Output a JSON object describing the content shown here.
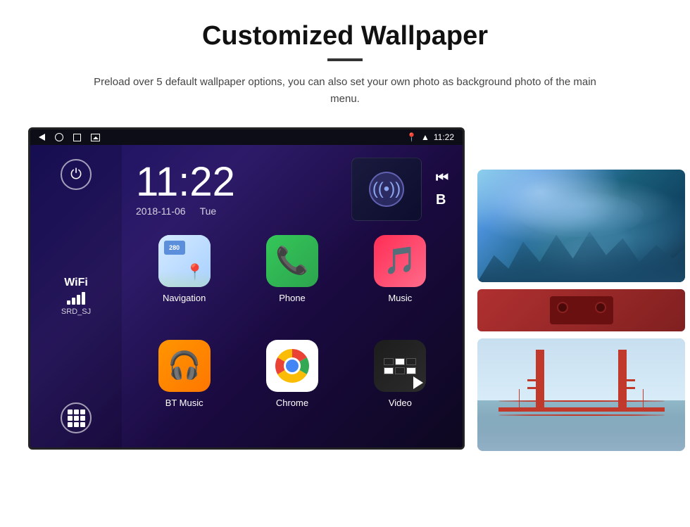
{
  "page": {
    "title": "Customized Wallpaper",
    "subtitle": "Preload over 5 default wallpaper options, you can also set your own photo as background photo of the main menu."
  },
  "android": {
    "statusBar": {
      "time": "11:22",
      "wifi": true,
      "location": true
    },
    "clock": {
      "time": "11:22",
      "date": "2018-11-06",
      "day": "Tue"
    },
    "wifi": {
      "label": "WiFi",
      "ssid": "SRD_SJ"
    },
    "apps": [
      {
        "name": "Navigation",
        "icon": "nav"
      },
      {
        "name": "Phone",
        "icon": "phone"
      },
      {
        "name": "Music",
        "icon": "music"
      },
      {
        "name": "BT Music",
        "icon": "btmusic"
      },
      {
        "name": "Chrome",
        "icon": "chrome"
      },
      {
        "name": "Video",
        "icon": "video"
      }
    ],
    "mediaButtons": [
      "K|",
      "B"
    ]
  },
  "wallpapers": [
    {
      "name": "ice-cave",
      "label": "Ice Cave"
    },
    {
      "name": "bridge",
      "label": "Golden Gate Bridge"
    }
  ],
  "colors": {
    "accent": "#4285f4",
    "background": "#ffffff"
  }
}
